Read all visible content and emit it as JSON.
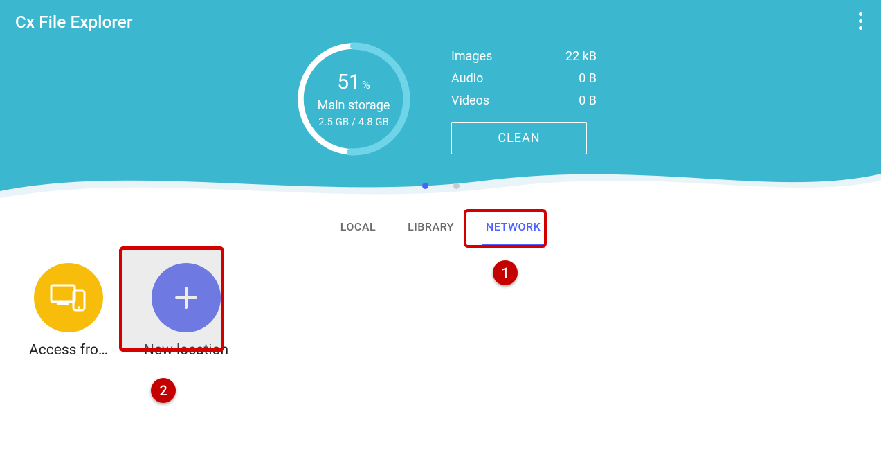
{
  "app": {
    "title": "Cx File Explorer"
  },
  "storage": {
    "percent": "51",
    "percent_suffix": "%",
    "label": "Main storage",
    "usage": "2.5 GB / 4.8 GB",
    "progress_fraction": 0.51
  },
  "stats": {
    "rows": [
      {
        "label": "Images",
        "value": "22 kB"
      },
      {
        "label": "Audio",
        "value": "0 B"
      },
      {
        "label": "Videos",
        "value": "0 B"
      }
    ],
    "clean_label": "CLEAN"
  },
  "pager": {
    "active_index": 0,
    "count": 2
  },
  "tabs": {
    "items": [
      {
        "label": "LOCAL"
      },
      {
        "label": "LIBRARY"
      },
      {
        "label": "NETWORK"
      }
    ],
    "active_index": 2
  },
  "grid": {
    "items": [
      {
        "label": "Access fro…",
        "icon": "devices-icon",
        "color": "yellow"
      },
      {
        "label": "New location",
        "icon": "plus-icon",
        "color": "blue"
      }
    ]
  },
  "annotations": {
    "badge1": "1",
    "badge2": "2"
  }
}
